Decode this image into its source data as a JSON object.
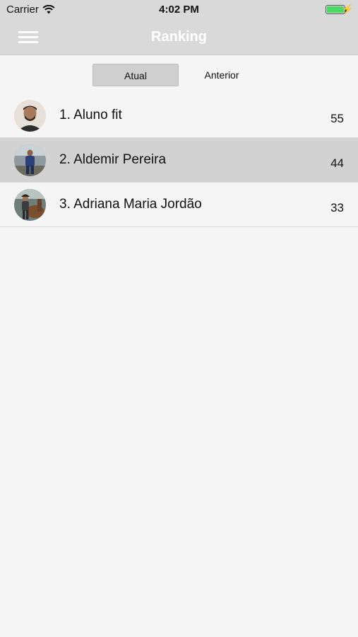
{
  "status_bar": {
    "carrier": "Carrier",
    "time": "4:02 PM",
    "wifi_icon": "wifi-icon",
    "battery_icon": "battery-icon",
    "battery_level": 1.0,
    "battery_color": "#4cd964"
  },
  "nav": {
    "title": "Ranking",
    "menu_icon": "hamburger-menu-icon"
  },
  "tabs": [
    {
      "label": "Atual",
      "selected": true
    },
    {
      "label": "Anterior",
      "selected": false
    }
  ],
  "ranking": [
    {
      "name": "1. Aluno fit",
      "score": "55",
      "highlighted": false
    },
    {
      "name": "2. Aldemir Pereira",
      "score": "44",
      "highlighted": true
    },
    {
      "name": "3. Adriana Maria Jordão",
      "score": "33",
      "highlighted": false
    }
  ],
  "colors": {
    "bar_background": "#d9d9d9",
    "page_background": "#f5f5f5",
    "highlight_row": "#d2d2d2",
    "title_text": "#ffffff"
  }
}
